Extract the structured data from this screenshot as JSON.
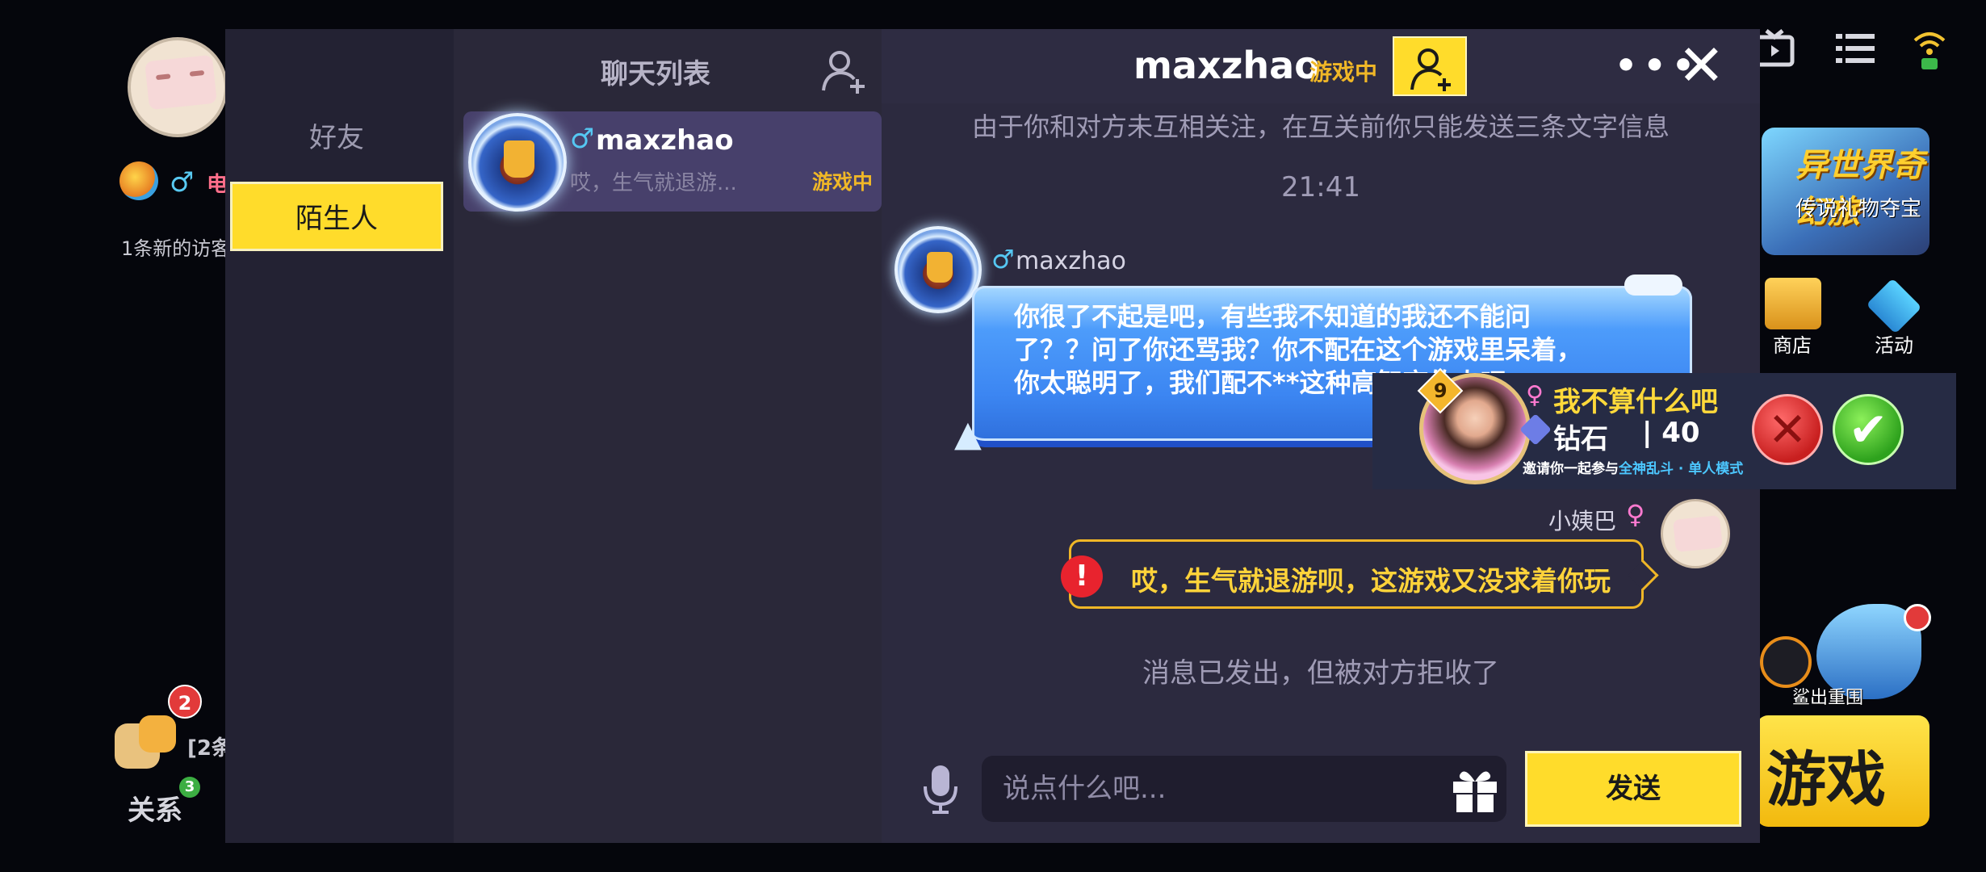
{
  "background": {
    "visitors_text": "1条新的访客",
    "pets_badge": "2",
    "pets_label": "[2条",
    "relations_label": "关系",
    "relations_badge": "3",
    "card1_title": "异世界奇幻旅",
    "card1_subtitle": "传说礼物夺宝",
    "shop_label": "商店",
    "activity_label": "活动",
    "shark_label": "鲨出重围",
    "game_label": "游戏",
    "profile_partial": "电"
  },
  "sidebar": {
    "tabs": [
      {
        "label": "好友"
      },
      {
        "label": "陌生人"
      }
    ]
  },
  "chat_list": {
    "title": "聊天列表",
    "items": [
      {
        "name": "maxzhao",
        "preview": "哎，生气就退游...",
        "status": "游戏中"
      }
    ]
  },
  "chat": {
    "header_name": "maxzhao",
    "header_status": "游戏中",
    "notice": "由于你和对方未互相关注，在互关前你只能发送三条文字信息",
    "time": "21:41",
    "incoming": {
      "name": "maxzhao",
      "text": "你很了不起是吧，有些我不知道的我还不能问了？？问了你还骂我？你不配在这个游戏里呆着，你太聪明了，我们配不**这种高智商的人吧"
    },
    "outgoing": {
      "name": "小姨巴",
      "text": "哎，生气就退游呗，这游戏又没求着你玩"
    },
    "rejected_notice": "消息已发出，但被对方拒收了",
    "input_placeholder": "说点什么吧...",
    "send_label": "发送"
  },
  "invite": {
    "level": "9",
    "name": "我不算什么吧",
    "rank": "钻石",
    "rank_value": "40",
    "text_prefix": "邀请你一起参与",
    "text_mode": "全神乱斗 · 单人模式"
  },
  "colors": {
    "accent_yellow": "#ffdc2b",
    "status_orange": "#f0b727",
    "bubble_blue": "#3c86f2"
  }
}
